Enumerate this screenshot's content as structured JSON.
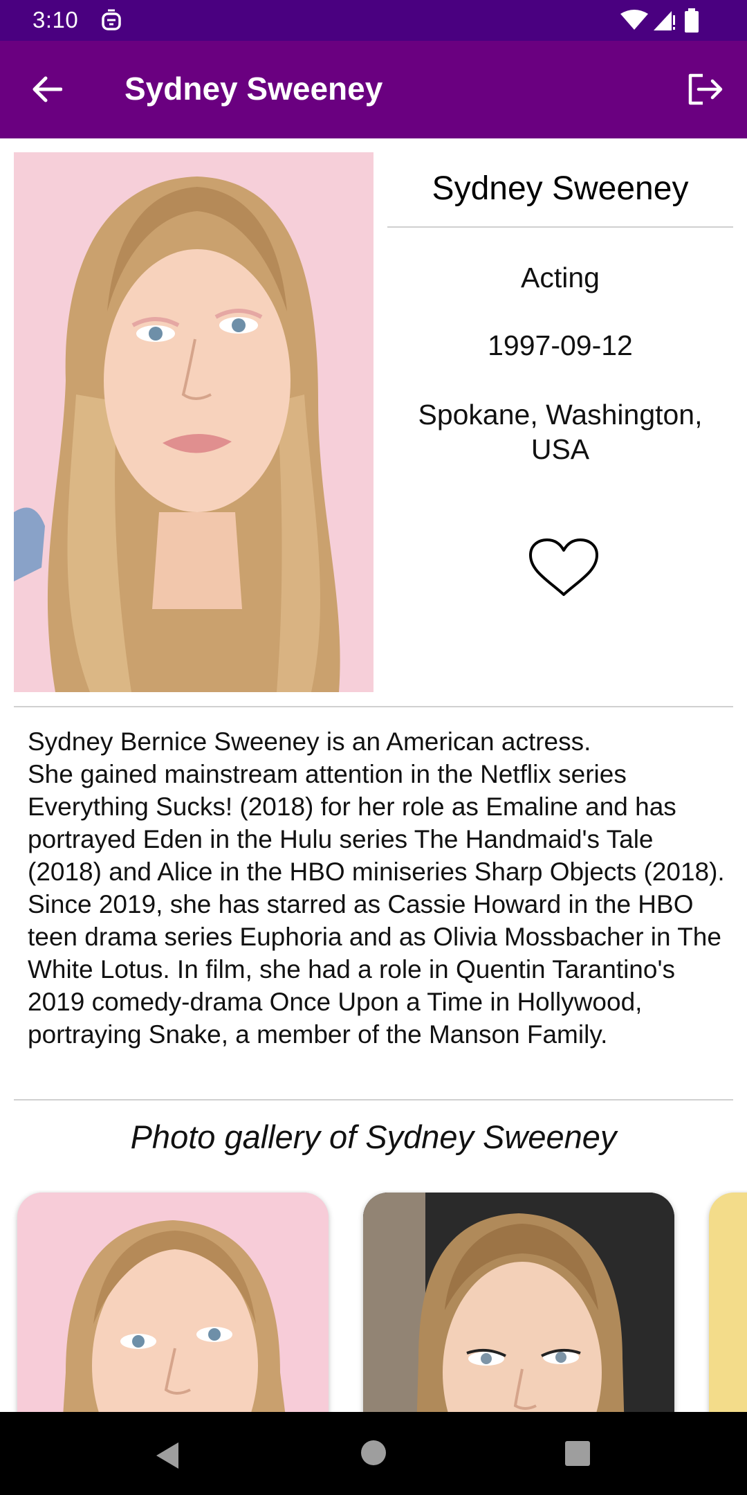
{
  "status_bar": {
    "time": "3:10",
    "notification_icon": "assistant-icon",
    "wifi_icon": "wifi-icon",
    "signal_icon": "cell-signal-icon",
    "battery_icon": "battery-icon"
  },
  "app_bar": {
    "title": "Sydney Sweeney",
    "back_icon": "arrow-back-icon",
    "logout_icon": "logout-icon",
    "background_color": "#6a0080",
    "status_bar_color": "#4a0080"
  },
  "person": {
    "name": "Sydney Sweeney",
    "known_for_department": "Acting",
    "birthday": "1997-09-12",
    "place_of_birth": "Spokane, Washington, USA",
    "favorite_icon": "heart-outline-icon",
    "biography": "Sydney Bernice Sweeney is an American actress.\nShe gained mainstream attention in the Netflix series Everything Sucks! (2018) for her role as Emaline and has portrayed Eden in the Hulu series The Handmaid's Tale (2018) and Alice in the HBO miniseries Sharp Objects (2018). Since 2019, she has starred as Cassie Howard in the HBO teen drama series Euphoria and as Olivia Mossbacher in The White Lotus. In film, she had a role in Quentin Tarantino's 2019 comedy-drama Once Upon a Time in Hollywood, portraying Snake, a member of the Manson Family."
  },
  "gallery": {
    "title": "Photo gallery of Sydney Sweeney"
  },
  "nav_bar": {
    "back_icon": "nav-back-icon",
    "home_icon": "nav-home-icon",
    "recents_icon": "nav-recents-icon"
  }
}
